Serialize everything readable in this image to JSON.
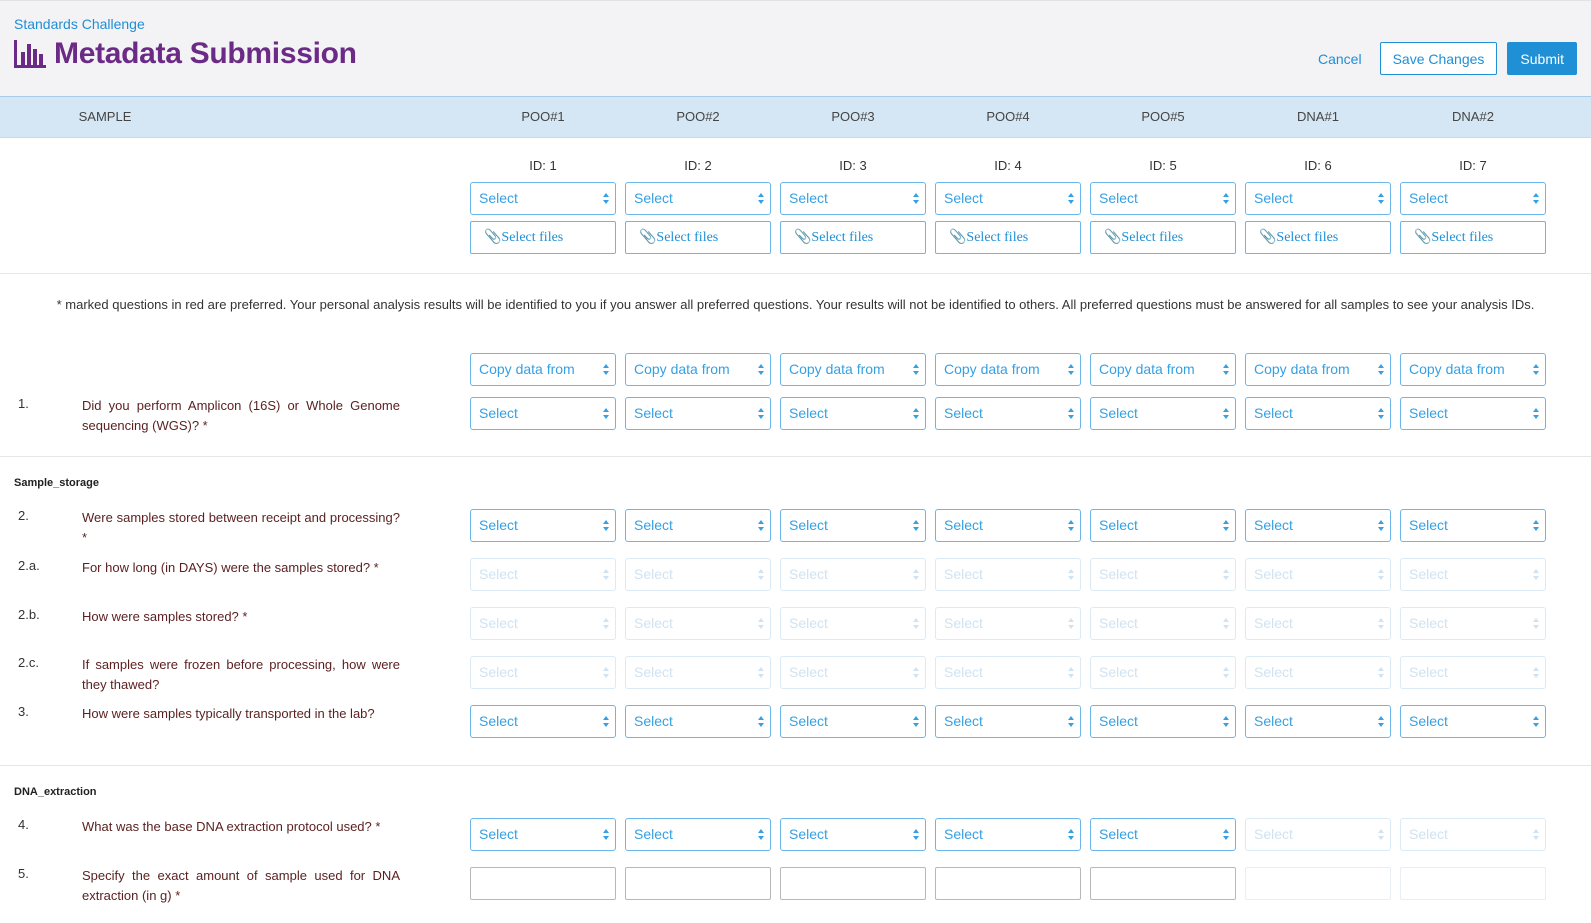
{
  "header": {
    "breadcrumb": "Standards Challenge",
    "title": "Metadata Submission",
    "cancel_label": "Cancel",
    "save_label": "Save Changes",
    "submit_label": "Submit"
  },
  "columns": {
    "sample_label": "SAMPLE",
    "names": [
      "POO#1",
      "POO#2",
      "POO#3",
      "POO#4",
      "POO#5",
      "DNA#1",
      "DNA#2"
    ],
    "ids": [
      "ID: 1",
      "ID: 2",
      "ID: 3",
      "ID: 4",
      "ID: 5",
      "ID: 6",
      "ID: 7"
    ]
  },
  "controls": {
    "select_placeholder": "Select",
    "files_label": "📎Select files",
    "copy_placeholder": "Copy data from"
  },
  "note": "* marked questions in red are preferred. Your personal analysis results will be identified to you if you answer all preferred questions. Your results will not be identified to others. All preferred questions must be answered for all samples to see your analysis IDs.",
  "sections": {
    "sample_storage": "Sample_storage",
    "dna_extraction": "DNA_extraction"
  },
  "questions": [
    {
      "num": "1.",
      "text": "Did you perform Amplicon (16S) or Whole Genome sequencing (WGS)? *"
    },
    {
      "num": "2.",
      "text": "Were samples stored between receipt and processing? *"
    },
    {
      "num": "2.a.",
      "text": "For how long (in DAYS) were the samples stored? *"
    },
    {
      "num": "2.b.",
      "text": "How were samples stored? *"
    },
    {
      "num": "2.c.",
      "text": "If samples were frozen before processing, how were they thawed?"
    },
    {
      "num": "3.",
      "text": "How were samples typically transported in the lab?"
    },
    {
      "num": "4.",
      "text": "What was the base DNA extraction protocol used? *"
    },
    {
      "num": "5.",
      "text": "Specify the exact amount of sample used for DNA extraction (in g) *"
    }
  ],
  "colors": {
    "accent": "#1f8fd6",
    "title": "#6a2a86",
    "header_band": "#d5e7f5",
    "question_text": "#5a1f1f"
  },
  "icons": {
    "title_icon": "bar-chart-icon",
    "file_icon": "paperclip-icon",
    "select_arrow": "updown-arrow-icon"
  }
}
